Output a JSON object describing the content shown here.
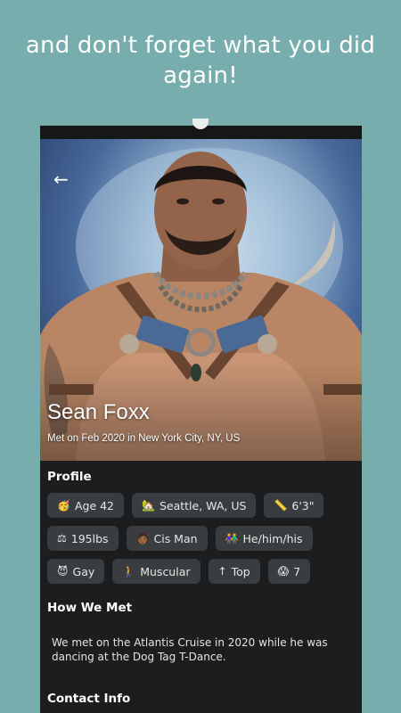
{
  "headline": "and don't forget what you did again!",
  "profile": {
    "name": "Sean Foxx",
    "met_line": "Met on Feb 2020 in New York City, NY, US"
  },
  "sections": {
    "profile": "Profile",
    "how_we_met": "How We Met",
    "contact_info": "Contact Info"
  },
  "chips": [
    {
      "icon": "🥳",
      "icon_name": "party-face-icon",
      "label": "Age 42"
    },
    {
      "icon": "🏡",
      "icon_name": "house-icon",
      "label": "Seattle, WA, US"
    },
    {
      "icon": "📏",
      "icon_name": "ruler-icon",
      "label": "6'3\""
    },
    {
      "icon": "⚖",
      "icon_name": "scale-icon",
      "label": "195lbs"
    },
    {
      "icon": "🧑🏾",
      "icon_name": "person-icon",
      "label": "Cis Man"
    },
    {
      "icon": "👫",
      "icon_name": "couple-icon",
      "label": "He/him/his"
    },
    {
      "icon": "😈",
      "icon_name": "devil-icon",
      "label": "Gay"
    },
    {
      "icon": "🚶",
      "icon_name": "walking-person-icon",
      "label": "Muscular"
    },
    {
      "icon": "↑",
      "icon_name": "up-arrow-icon",
      "label": "Top"
    },
    {
      "icon": "😱",
      "icon_name": "screaming-face-icon",
      "label": "7"
    }
  ],
  "how_we_met_text": "We met on the Atlantis Cruise in 2020 while he was dancing at the Dog Tag T-Dance.",
  "back_icon": "←"
}
